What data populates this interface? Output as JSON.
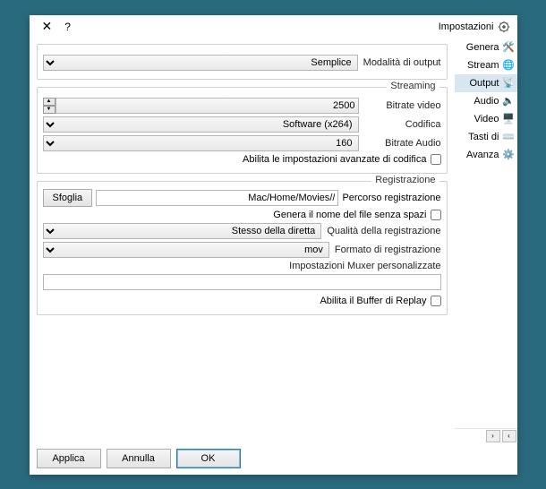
{
  "title": "Impostazioni",
  "help": "?",
  "close": "✕",
  "sidebar": {
    "items": [
      {
        "label": "Genera"
      },
      {
        "label": "Stream"
      },
      {
        "label": "Output"
      },
      {
        "label": "Audio"
      },
      {
        "label": "Video"
      },
      {
        "label": "Tasti di"
      },
      {
        "label": "Avanza"
      }
    ],
    "scroll_left": "‹",
    "scroll_right": "›"
  },
  "output": {
    "mode_label": "Modalità di output",
    "mode_value": "Semplice",
    "streaming_legend": "Streaming",
    "video_bitrate_label": "Bitrate video",
    "video_bitrate_value": "2500",
    "encoder_label": "Codifica",
    "encoder_value": "Software (x264)",
    "audio_bitrate_label": "Bitrate Audio",
    "audio_bitrate_value": "160",
    "advanced_checkbox": "Abilita le impostazioni avanzate di codifica",
    "recording_legend": "Registrazione",
    "rec_path_label": "Percorso registrazione",
    "rec_path_value": "//Mac/Home/Movies",
    "browse_label": "Sfoglia",
    "nospaces_label": "Genera il nome del file senza spazi",
    "quality_label": "Qualità della registrazione",
    "quality_value": "Stesso della diretta",
    "format_label": "Formato di registrazione",
    "format_value": "mov",
    "muxer_label": "Impostazioni Muxer personalizzate",
    "muxer_value": "",
    "replay_label": "Abilita il Buffer di Replay"
  },
  "footer": {
    "ok": "OK",
    "cancel": "Annulla",
    "apply": "Applica"
  }
}
